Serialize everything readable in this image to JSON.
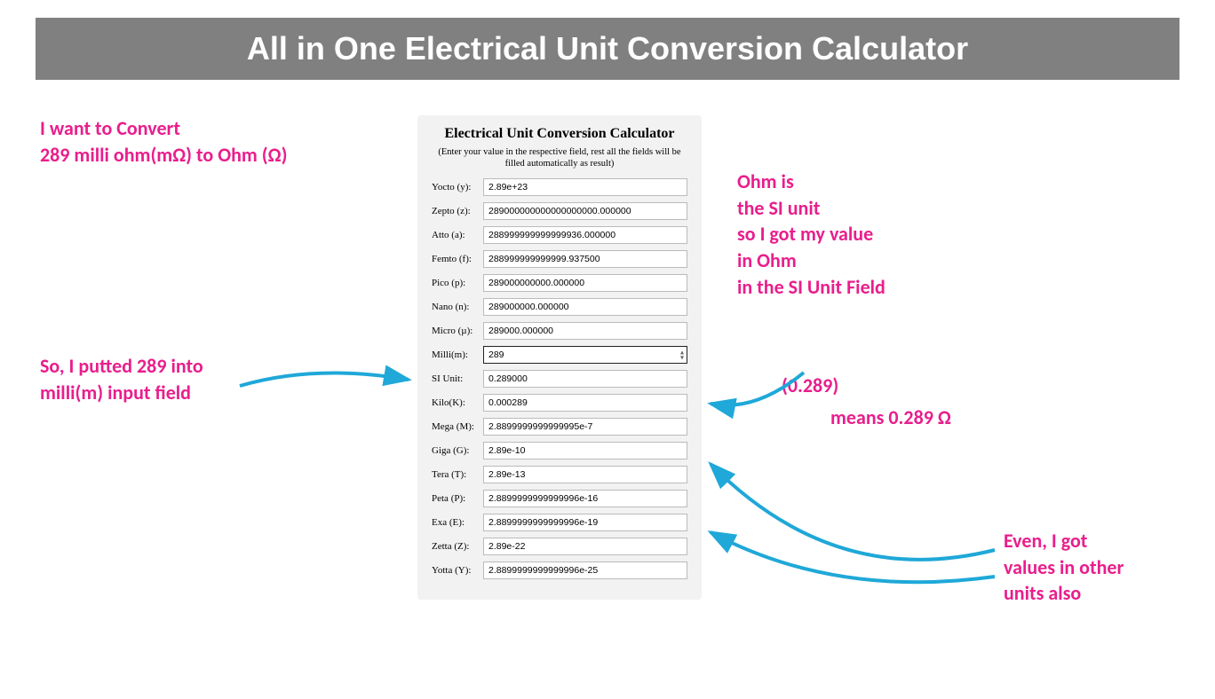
{
  "header": {
    "title": "All in One Electrical Unit Conversion Calculator"
  },
  "calculator": {
    "title": "Electrical Unit Conversion Calculator",
    "subtitle": "(Enter your value in the respective field, rest all the fields will be filled automatically as result)",
    "fields": [
      {
        "label": "Yocto (y):",
        "value": "2.89e+23"
      },
      {
        "label": "Zepto (z):",
        "value": "289000000000000000000.000000"
      },
      {
        "label": "Atto (a):",
        "value": "288999999999999936.000000"
      },
      {
        "label": "Femto (f):",
        "value": "288999999999999.937500"
      },
      {
        "label": "Pico (p):",
        "value": "289000000000.000000"
      },
      {
        "label": "Nano (n):",
        "value": "289000000.000000"
      },
      {
        "label": "Micro (µ):",
        "value": "289000.000000"
      },
      {
        "label": "Milli(m):",
        "value": "289",
        "active": true
      },
      {
        "label": "SI Unit:",
        "value": "0.289000"
      },
      {
        "label": "Kilo(K):",
        "value": "0.000289"
      },
      {
        "label": "Mega (M):",
        "value": "2.8899999999999995e-7"
      },
      {
        "label": "Giga (G):",
        "value": "2.89e-10"
      },
      {
        "label": "Tera (T):",
        "value": "2.89e-13"
      },
      {
        "label": "Peta (P):",
        "value": "2.8899999999999996e-16"
      },
      {
        "label": "Exa (E):",
        "value": "2.8899999999999996e-19"
      },
      {
        "label": "Zetta (Z):",
        "value": "2.89e-22"
      },
      {
        "label": "Yotta (Y):",
        "value": "2.8899999999999996e-25"
      }
    ]
  },
  "annotations": {
    "top_left_line1": "I want to Convert",
    "top_left_line2": "289 milli ohm(mΩ) to Ohm (Ω)",
    "mid_left_line1": "So, I putted 289 into",
    "mid_left_line2": "milli(m) input field",
    "top_right_line1": "Ohm is",
    "top_right_line2": "the SI unit",
    "top_right_line3": "so I got my value",
    "top_right_line4": "in Ohm",
    "top_right_line5": "in the SI Unit Field",
    "right2_line1": "(0.289)",
    "right3_line1": "means 0.289 Ω",
    "bottom_right_line1": "Even, I got",
    "bottom_right_line2": "values in other",
    "bottom_right_line3": "units also"
  },
  "colors": {
    "header_bg": "#808080",
    "annotation": "#e91e8c",
    "arrow": "#1fa8d8"
  }
}
